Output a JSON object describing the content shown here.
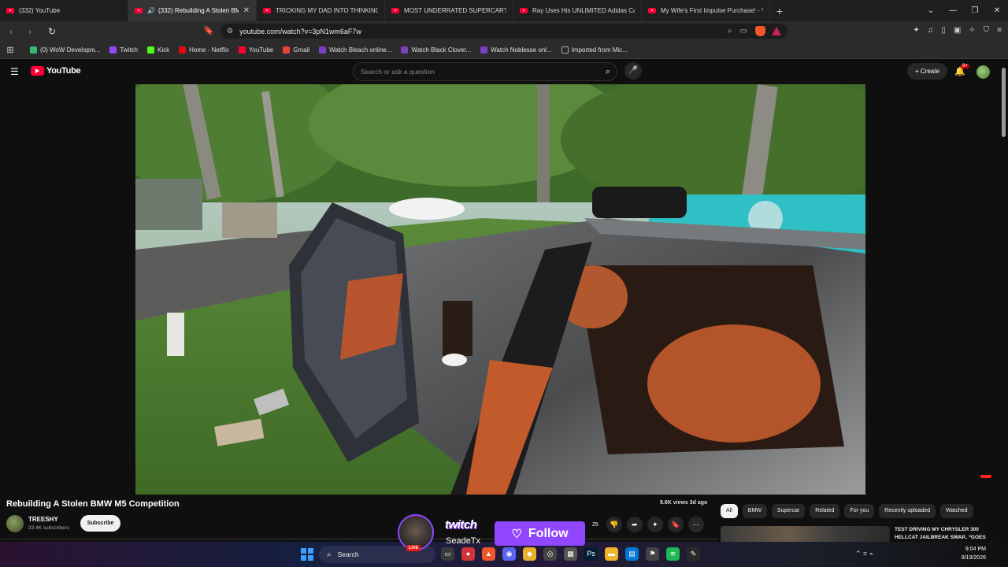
{
  "browser": {
    "tabs": [
      {
        "title": "(332) YouTube",
        "active": false
      },
      {
        "title": "(332) Rebuilding A Stolen BM",
        "active": true
      },
      {
        "title": "TRICKING MY DAD INTO THINKING",
        "active": false
      },
      {
        "title": "MOST UNDERRATED SUPERCAR? - M",
        "active": false
      },
      {
        "title": "Ray Uses His UNLIMITED Adidas Ca",
        "active": false
      },
      {
        "title": "My Wife's First Impulse Purchase! - Y",
        "active": false
      }
    ],
    "new_tab": "+",
    "url": "youtube.com/watch?v=3pN1wm6aF7w",
    "bookmarks": [
      {
        "label": "(0) WoW Developm...",
        "color": "#3bb86f"
      },
      {
        "label": "Twitch",
        "color": "#9146ff"
      },
      {
        "label": "Kick",
        "color": "#53fc18"
      },
      {
        "label": "Home - Netflix",
        "color": "#e50914"
      },
      {
        "label": "YouTube",
        "color": "#ff0033"
      },
      {
        "label": "Gmail",
        "color": "#ea4335"
      },
      {
        "label": "Watch Bleach online...",
        "color": "#7b3fbf"
      },
      {
        "label": "Watch Black Clover...",
        "color": "#7b3fbf"
      },
      {
        "label": "Watch Noblesse onl...",
        "color": "#7b3fbf"
      },
      {
        "label": "Imported from Mic...",
        "color": "#888888"
      }
    ]
  },
  "youtube": {
    "logo_text": "YouTube",
    "search_placeholder": "Search or ask a question",
    "create_label": "+ Create",
    "notification_badge": "9+",
    "video": {
      "title": "Rebuilding A Stolen BMW M5 Competition",
      "channel": "TREESHY",
      "subscribers": "33.4K subscribers",
      "subscribe_label": "Subscribe",
      "views_age": "9.6K views  3d ago",
      "like_count": "25"
    },
    "chips": [
      "All",
      "BMW",
      "Supercar",
      "Related",
      "For you",
      "Recently uploaded",
      "Watched"
    ],
    "recommended": {
      "title_line1": "TEST DRIVING MY CHRYSLER 300",
      "title_line2": "HELLCAT JAILBREAK SWAP.. *GOES"
    }
  },
  "twitch_overlay": {
    "logo": "twitch",
    "name": "SeadeTx",
    "follow_label": "Follow",
    "live_label": "LIVE"
  },
  "taskbar": {
    "search_label": "Search",
    "time": "9:04 PM",
    "date": "8/19/2026"
  }
}
